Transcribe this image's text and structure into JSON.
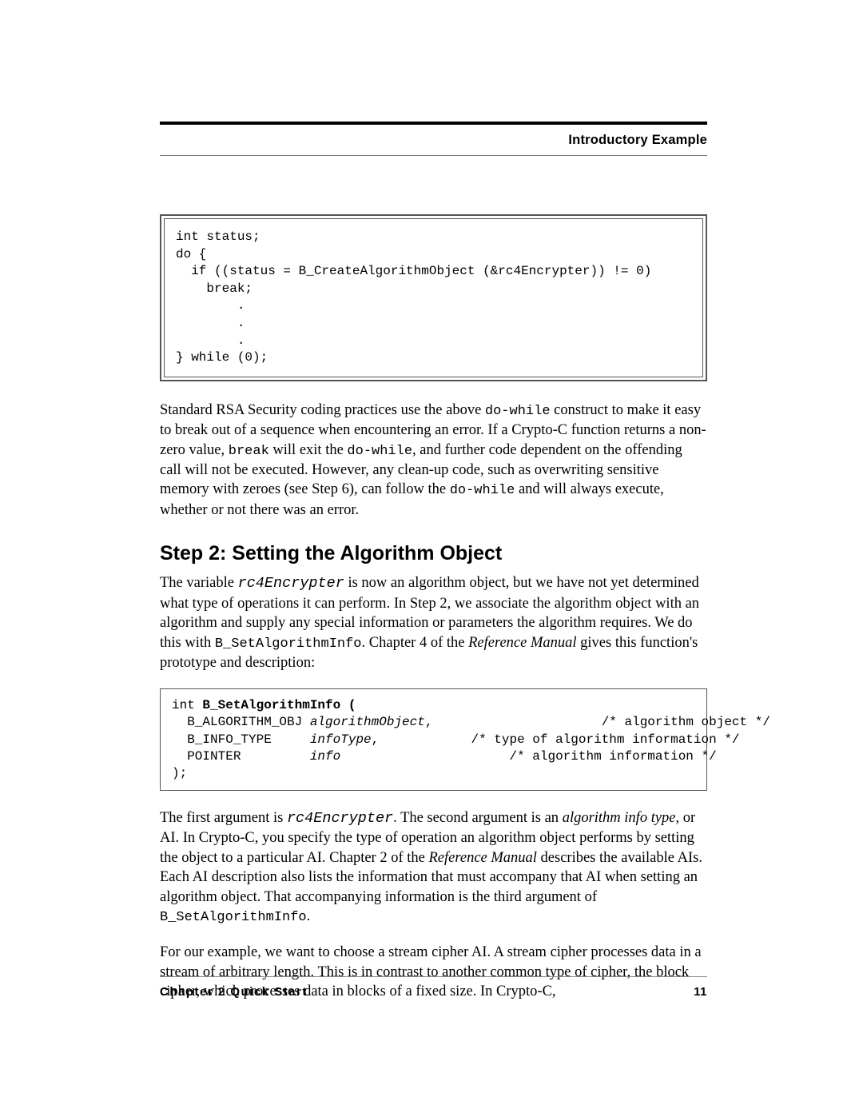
{
  "header": {
    "section_title": "Introductory Example"
  },
  "code1": "int status;\ndo {\n  if ((status = B_CreateAlgorithmObject (&rc4Encrypter)) != 0)\n    break;\n        .\n        .\n        .\n} while (0);",
  "para1": {
    "t1": "Standard RSA Security coding practices use the above ",
    "c1": "do-while",
    "t2": " construct to make it easy to break out of a sequence when encountering an error. If a Crypto-C function returns a non-zero value, ",
    "c2": "break",
    "t3": " will exit the ",
    "c3": "do-while",
    "t4": ", and further code dependent on the offending call will not be executed. However, any clean-up code, such as overwriting sensitive memory with zeroes (see Step 6), can follow the ",
    "c4": "do-while",
    "t5": " and will always execute, whether or not there was an error."
  },
  "heading_step2": "Step 2:  Setting the Algorithm Object",
  "para2": {
    "t1": "The variable ",
    "c1": "rc4Encrypter",
    "t2": " is now an algorithm object, but we have not yet determined what type of operations it can perform. In Step 2, we associate the algorithm object with an algorithm and supply any special information or parameters the algorithm requires. We do this with ",
    "c2": "B_SetAlgorithmInfo",
    "t3": ". Chapter 4 of the ",
    "i1": "Reference Manual",
    "t4": " gives this function's prototype and description:"
  },
  "code2": {
    "l1a": "int ",
    "l1b": "B_SetAlgorithmInfo (",
    "l2a": "  B_ALGORITHM_OBJ ",
    "l2b": "algorithmObject",
    "l2c": ",                      /* algorithm object */",
    "l3a": "  B_INFO_TYPE     ",
    "l3b": "infoType",
    "l3c": ",            /* type of algorithm information */",
    "l4a": "  POINTER         ",
    "l4b": "info",
    "l4c": "                      /* algorithm information */",
    "l5": ");"
  },
  "para3": {
    "t1": "The first argument is ",
    "c1": "rc4Encrypter",
    "t2": ". The second argument is an ",
    "i1": "algorithm info type",
    "t3": ", or AI. In Crypto-C, you specify the type of operation an algorithm object performs by setting the object to a particular AI. Chapter 2 of the ",
    "i2": "Reference Manual",
    "t4": " describes the available AIs. Each AI description also lists the information that must accompany that AI when setting an algorithm object. That accompanying information is the third argument of ",
    "c2": "B_SetAlgorithmInfo",
    "t5": "."
  },
  "para4": "For our example, we want to choose a stream cipher AI. A stream cipher processes data in a stream of arbitrary length. This is in contrast to another common type of cipher, the block cipher, which processes data in blocks of a fixed size. In Crypto-C,",
  "footer": {
    "chapter": "Chapter 2  Quick Start",
    "page": "11"
  }
}
